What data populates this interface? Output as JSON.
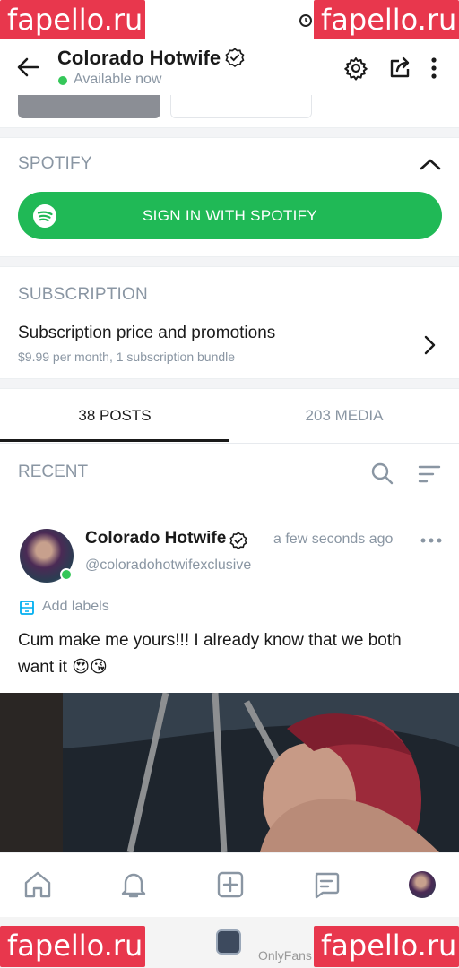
{
  "watermarks": [
    "fapello.ru",
    "fapello.ru",
    "fapello.ru",
    "fapello.ru"
  ],
  "header": {
    "title": "Colorado Hotwife",
    "status": "Available now",
    "icons": [
      "back-arrow-icon",
      "verified-badge-icon",
      "gear-icon",
      "share-icon",
      "more-vertical-icon"
    ]
  },
  "spotify": {
    "heading": "SPOTIFY",
    "button_label": "SIGN IN WITH SPOTIFY"
  },
  "subscription": {
    "heading": "SUBSCRIPTION",
    "title": "Subscription price and promotions",
    "detail": "$9.99 per month, 1 subscription bundle"
  },
  "tabs": [
    {
      "label": "38 POSTS",
      "active": true
    },
    {
      "label": "203 MEDIA",
      "active": false
    }
  ],
  "feed": {
    "heading": "RECENT"
  },
  "post": {
    "author": "Colorado Hotwife",
    "handle": "@coloradohotwifexclusive",
    "time": "a few seconds ago",
    "add_labels": "Add labels",
    "text": "Cum make me yours!!! I already know that we both want it 😍😘"
  },
  "bottom_nav": [
    "home-icon",
    "bell-icon",
    "add-post-icon",
    "messages-icon",
    "profile-avatar"
  ],
  "system_bar": {
    "text": "OnlyFans"
  },
  "colors": {
    "spotify_green": "#20b956",
    "online_green": "#35c759",
    "muted_text": "#8a96a3",
    "watermark_red": "#e8374d"
  }
}
